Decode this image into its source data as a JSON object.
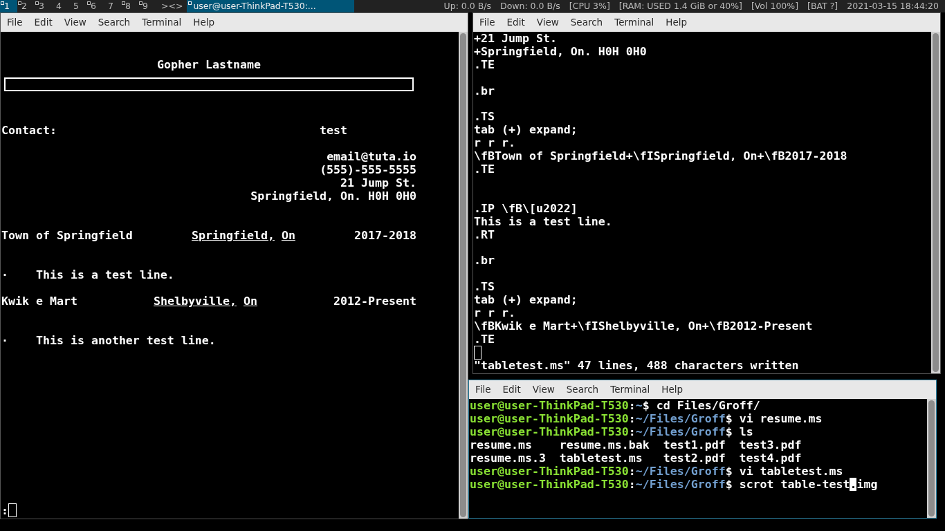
{
  "top_bar": {
    "workspaces": [
      {
        "label": "1",
        "selected": true,
        "occupied": true
      },
      {
        "label": "2",
        "selected": false,
        "occupied": true
      },
      {
        "label": "3",
        "selected": false,
        "occupied": true
      },
      {
        "label": "4",
        "selected": false,
        "occupied": false
      },
      {
        "label": "5",
        "selected": false,
        "occupied": false
      },
      {
        "label": "6",
        "selected": false,
        "occupied": true
      },
      {
        "label": "7",
        "selected": false,
        "occupied": false
      },
      {
        "label": "8",
        "selected": false,
        "occupied": true
      },
      {
        "label": "9",
        "selected": false,
        "occupied": true
      }
    ],
    "layout": "><>",
    "window_title": "user@user-ThinkPad-T530:...",
    "status": [
      "Up: 0.0 B/s",
      "Down: 0.0 B/s",
      "[CPU 3%]",
      "[RAM: USED 1.4 GiB or 40%]",
      "[Vol 100%]",
      "[BAT ?]",
      "2021-03-15 18:44:20"
    ]
  },
  "left_terminal": {
    "focused": false,
    "menu": [
      "File",
      "Edit",
      "View",
      "Search",
      "Terminal",
      "Help"
    ],
    "document": {
      "name": "Gopher Lastname",
      "contact": {
        "label": "Contact:",
        "value": "test"
      },
      "address": [
        "email@tuta.io",
        "(555)-555-5555",
        "21 Jump St.",
        "Springfield, On. H0H 0H0"
      ],
      "entries": [
        {
          "employer": "Town of Springfield",
          "location": "Springfield,",
          "region": "On",
          "dates": "2017-2018",
          "bullets": [
            {
              "marker": "·",
              "text": "This is a test line."
            }
          ]
        },
        {
          "employer": "Kwik e Mart",
          "location": "Shelbyville,",
          "region": "On",
          "dates": "2012-Present",
          "bullets": [
            {
              "marker": "·",
              "text": "This is another test line."
            }
          ]
        }
      ]
    },
    "command_line": ":"
  },
  "right_top_terminal": {
    "focused": false,
    "menu": [
      "File",
      "Edit",
      "View",
      "Search",
      "Terminal",
      "Help"
    ],
    "buffer": [
      {
        "kind": "text",
        "text": "+21 Jump St."
      },
      {
        "kind": "text",
        "text": "+Springfield, On. H0H 0H0"
      },
      {
        "kind": "text",
        "text": ".TE"
      },
      {
        "kind": "blank"
      },
      {
        "kind": "text",
        "text": ".br"
      },
      {
        "kind": "blank"
      },
      {
        "kind": "text",
        "text": ".TS"
      },
      {
        "kind": "text",
        "text": "tab (+) expand;"
      },
      {
        "kind": "text",
        "text": "r r r."
      },
      {
        "kind": "text",
        "text": "\\fBTown of Springfield+\\fISpringfield, On+\\fB2017-2018"
      },
      {
        "kind": "text",
        "text": ".TE"
      },
      {
        "kind": "blank"
      },
      {
        "kind": "blank"
      },
      {
        "kind": "text",
        "text": ".IP \\fB\\[u2022]"
      },
      {
        "kind": "text",
        "text": "This is a test line."
      },
      {
        "kind": "text",
        "text": ".RT"
      },
      {
        "kind": "blank"
      },
      {
        "kind": "text",
        "text": ".br"
      },
      {
        "kind": "blank"
      },
      {
        "kind": "text",
        "text": ".TS"
      },
      {
        "kind": "text",
        "text": "tab (+) expand;"
      },
      {
        "kind": "text",
        "text": "r r r."
      },
      {
        "kind": "text",
        "text": "\\fBKwik e Mart+\\fIShelbyville, On+\\fB2012-Present"
      },
      {
        "kind": "text",
        "text": ".TE"
      },
      {
        "kind": "cursor"
      }
    ],
    "message": "\"tabletest.ms\" 47 lines, 488 characters written"
  },
  "right_bottom_terminal": {
    "focused": true,
    "menu": [
      "File",
      "Edit",
      "View",
      "Search",
      "Terminal",
      "Help"
    ],
    "lines": [
      [
        {
          "kind": "host",
          "text": "user@user-ThinkPad-T530"
        },
        {
          "kind": "plain",
          "text": ":"
        },
        {
          "kind": "path",
          "text": "~"
        },
        {
          "kind": "plain",
          "text": "$ cd Files/Groff/"
        }
      ],
      [
        {
          "kind": "host",
          "text": "user@user-ThinkPad-T530"
        },
        {
          "kind": "plain",
          "text": ":"
        },
        {
          "kind": "path",
          "text": "~/Files/Groff"
        },
        {
          "kind": "plain",
          "text": "$ vi resume.ms"
        }
      ],
      [
        {
          "kind": "host",
          "text": "user@user-ThinkPad-T530"
        },
        {
          "kind": "plain",
          "text": ":"
        },
        {
          "kind": "path",
          "text": "~/Files/Groff"
        },
        {
          "kind": "plain",
          "text": "$ ls"
        }
      ],
      [
        {
          "kind": "plain",
          "text": "resume.ms    resume.ms.bak  test1.pdf  test3.pdf"
        }
      ],
      [
        {
          "kind": "plain",
          "text": "resume.ms.3  tabletest.ms   test2.pdf  test4.pdf"
        }
      ],
      [
        {
          "kind": "host",
          "text": "user@user-ThinkPad-T530"
        },
        {
          "kind": "plain",
          "text": ":"
        },
        {
          "kind": "path",
          "text": "~/Files/Groff"
        },
        {
          "kind": "plain",
          "text": "$ vi tabletest.ms"
        }
      ],
      [
        {
          "kind": "host",
          "text": "user@user-ThinkPad-T530"
        },
        {
          "kind": "plain",
          "text": ":"
        },
        {
          "kind": "path",
          "text": "~/Files/Groff"
        },
        {
          "kind": "plain",
          "text": "$ scrot table-test"
        },
        {
          "kind": "cursor",
          "text": "."
        },
        {
          "kind": "plain",
          "text": "img"
        }
      ]
    ]
  }
}
